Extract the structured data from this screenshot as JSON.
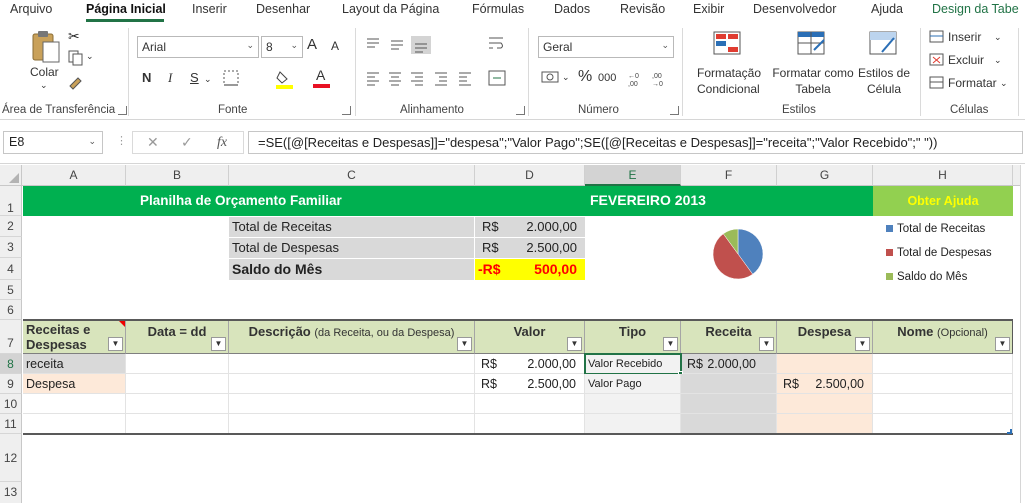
{
  "menu": [
    "Arquivo",
    "Página Inicial",
    "Inserir",
    "Desenhar",
    "Layout da Página",
    "Fórmulas",
    "Dados",
    "Revisão",
    "Exibir",
    "Desenvolvedor",
    "Ajuda",
    "Design da Tabe"
  ],
  "ribbon": {
    "clipboard": {
      "paste": "Colar",
      "label": "Área de Transferência"
    },
    "font": {
      "name": "Arial",
      "size": "8",
      "bold": "N",
      "italic": "I",
      "underline": "S",
      "label": "Fonte",
      "grow": "A",
      "shrink": "A"
    },
    "alignment": {
      "label": "Alinhamento"
    },
    "number": {
      "format": "Geral",
      "label": "Número",
      "percent": "%",
      "thousands": "000"
    },
    "styles": {
      "conditional": "Formatação Condicional",
      "table": "Formatar como Tabela",
      "cell": "Estilos de Célula",
      "label": "Estilos"
    },
    "cells": {
      "insert": "Inserir",
      "delete": "Excluir",
      "format": "Formatar",
      "label": "Células"
    }
  },
  "formula_bar": {
    "name_box": "E8",
    "fx": "fx",
    "formula": "=SE([@[Receitas e  Despesas]]=\"despesa\";\"Valor Pago\";SE([@[Receitas e  Despesas]]=\"receita\";\"Valor Recebido\";\" \"))"
  },
  "columns": [
    "A",
    "B",
    "C",
    "D",
    "E",
    "F",
    "G",
    "H"
  ],
  "rows": [
    "1",
    "2",
    "3",
    "4",
    "5",
    "6",
    "7",
    "8",
    "9",
    "10",
    "11",
    "12",
    "13"
  ],
  "sheet": {
    "title": "Planilha de Orçamento Familiar",
    "month": "FEVEREIRO  2013",
    "help": "Obter Ajuda",
    "summary": [
      {
        "label": "Total de Receitas",
        "cur": "R$",
        "value": "2.000,00"
      },
      {
        "label": "Total de Despesas",
        "cur": "R$",
        "value": "2.500,00"
      },
      {
        "label": "Saldo do Mês",
        "cur": "-R$",
        "value": "500,00"
      }
    ],
    "headers": {
      "a": "Receitas e Despesas",
      "b": "Data = dd",
      "c_main": "Descrição",
      "c_sub": "(da Receita, ou da Despesa)",
      "d": "Valor",
      "e": "Tipo",
      "f": "Receita",
      "g": "Despesa",
      "h_main": "Nome",
      "h_sub": "(Opcional)"
    },
    "row8": {
      "a": "receita",
      "d_cur": "R$",
      "d_val": "2.000,00",
      "e": "Valor Recebido",
      "f_cur": "R$",
      "f_val": "2.000,00"
    },
    "row9": {
      "a": "Despesa",
      "d_cur": "R$",
      "d_val": "2.500,00",
      "e": "Valor Pago",
      "g_cur": "R$",
      "g_val": "2.500,00"
    }
  },
  "chart_data": {
    "type": "pie",
    "categories": [
      "Total de Receitas",
      "Total de Despesas",
      "Saldo do Mês"
    ],
    "values": [
      2000,
      2500,
      500
    ],
    "colors": [
      "#4f81bd",
      "#c0504d",
      "#9bbb59"
    ],
    "legend": "right"
  }
}
